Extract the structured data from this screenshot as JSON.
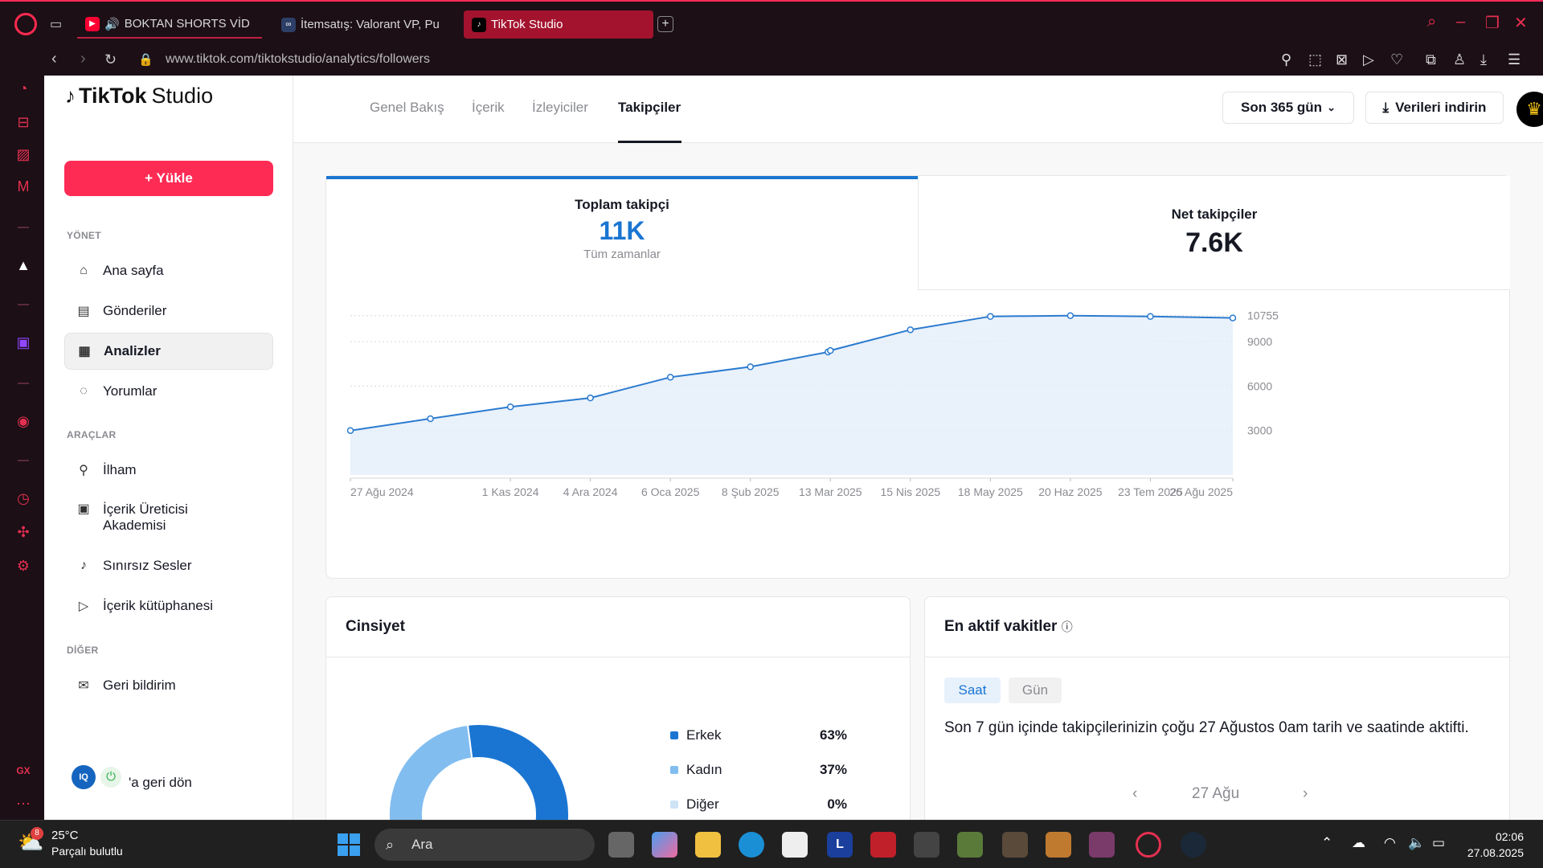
{
  "browser": {
    "tabs": [
      {
        "label": "BOKTAN SHORTS VİD",
        "icon": "youtube-icon"
      },
      {
        "label": "İtemsatış: Valorant VP, Pu",
        "icon": "itemsatis-icon"
      },
      {
        "label": "TikTok Studio",
        "icon": "tiktok-icon"
      }
    ],
    "new_tab": "+",
    "url": "www.tiktok.com/tiktokstudio/analytics/followers",
    "sidebar_badge": "GX"
  },
  "brand": {
    "name": "TikTok",
    "suffix": "Studio"
  },
  "sidebar": {
    "upload_label": "+ Yükle",
    "sections": {
      "manage": "YÖNET",
      "tools": "ARAÇLAR",
      "other": "DİĞER"
    },
    "items": [
      {
        "label": "Ana sayfa",
        "icon": "home-icon"
      },
      {
        "label": "Gönderiler",
        "icon": "posts-icon"
      },
      {
        "label": "Analizler",
        "icon": "analytics-icon"
      },
      {
        "label": "Yorumlar",
        "icon": "comments-icon"
      },
      {
        "label": "İlham",
        "icon": "lightbulb-icon"
      },
      {
        "label": "İçerik Üreticisi Akademisi",
        "icon": "academy-icon"
      },
      {
        "label": "Sınırsız Sesler",
        "icon": "music-icon"
      },
      {
        "label": "İçerik kütüphanesi",
        "icon": "library-icon"
      },
      {
        "label": "Geri bildirim",
        "icon": "feedback-icon"
      }
    ],
    "back_link": "'a geri dön"
  },
  "topbar": {
    "tabs": [
      "Genel Bakış",
      "İçerik",
      "İzleyiciler",
      "Takipçiler"
    ],
    "active_tab": "Takipçiler",
    "range": "Son 365 gün",
    "download": "Verileri indirin"
  },
  "stats": {
    "total": {
      "label": "Toplam takipçi",
      "value": "11K",
      "sub": "Tüm zamanlar"
    },
    "net": {
      "label": "Net takipçiler",
      "value": "7.6K"
    }
  },
  "chart_data": {
    "type": "area",
    "x": [
      "27 Ağu 2024",
      "1 Kas 2024",
      "4 Ara 2024",
      "6 Oca 2025",
      "8 Şub 2025",
      "13 Mar 2025",
      "15 Nis 2025",
      "18 May 2025",
      "20 Haz 2025",
      "23 Tem 2025",
      "26 Ağu 2025"
    ],
    "tick_positions": [
      0,
      66,
      99,
      132,
      165,
      198,
      231,
      264,
      297,
      330,
      364
    ],
    "series": [
      {
        "days": [
          0,
          33,
          66,
          99,
          132,
          165,
          197,
          198,
          231,
          264,
          297,
          330,
          364
        ],
        "values": [
          3000,
          3800,
          4600,
          5200,
          6600,
          7300,
          8300,
          8400,
          9800,
          10700,
          10755,
          10700,
          10600
        ]
      }
    ],
    "yticks": [
      3000,
      6000,
      9000,
      10755
    ],
    "ylim": [
      0,
      11500
    ],
    "grid": true,
    "color": "#2b7bcf",
    "fill": "#e3eefa"
  },
  "gender": {
    "title": "Cinsiyet",
    "rows": [
      {
        "label": "Erkek",
        "pct": "63%",
        "value": 63,
        "color": "#1a75d2"
      },
      {
        "label": "Kadın",
        "pct": "37%",
        "value": 37,
        "color": "#82bdf0"
      },
      {
        "label": "Diğer",
        "pct": "0%",
        "value": 0,
        "color": "#cfe3f7"
      }
    ]
  },
  "active_times": {
    "title": "En aktif vakitler",
    "toggle": [
      "Saat",
      "Gün"
    ],
    "text": "Son 7 gün içinde takipçilerinizin çoğu 27 Ağustos 0am tarih ve saatinde aktifti.",
    "date": "27 Ağu"
  },
  "taskbar": {
    "weather_temp": "25°C",
    "weather_desc": "Parçalı bulutlu",
    "weather_badge": "8",
    "search": "Ara",
    "time": "02:06",
    "date": "27.08.2025",
    "app_letter": "L"
  }
}
